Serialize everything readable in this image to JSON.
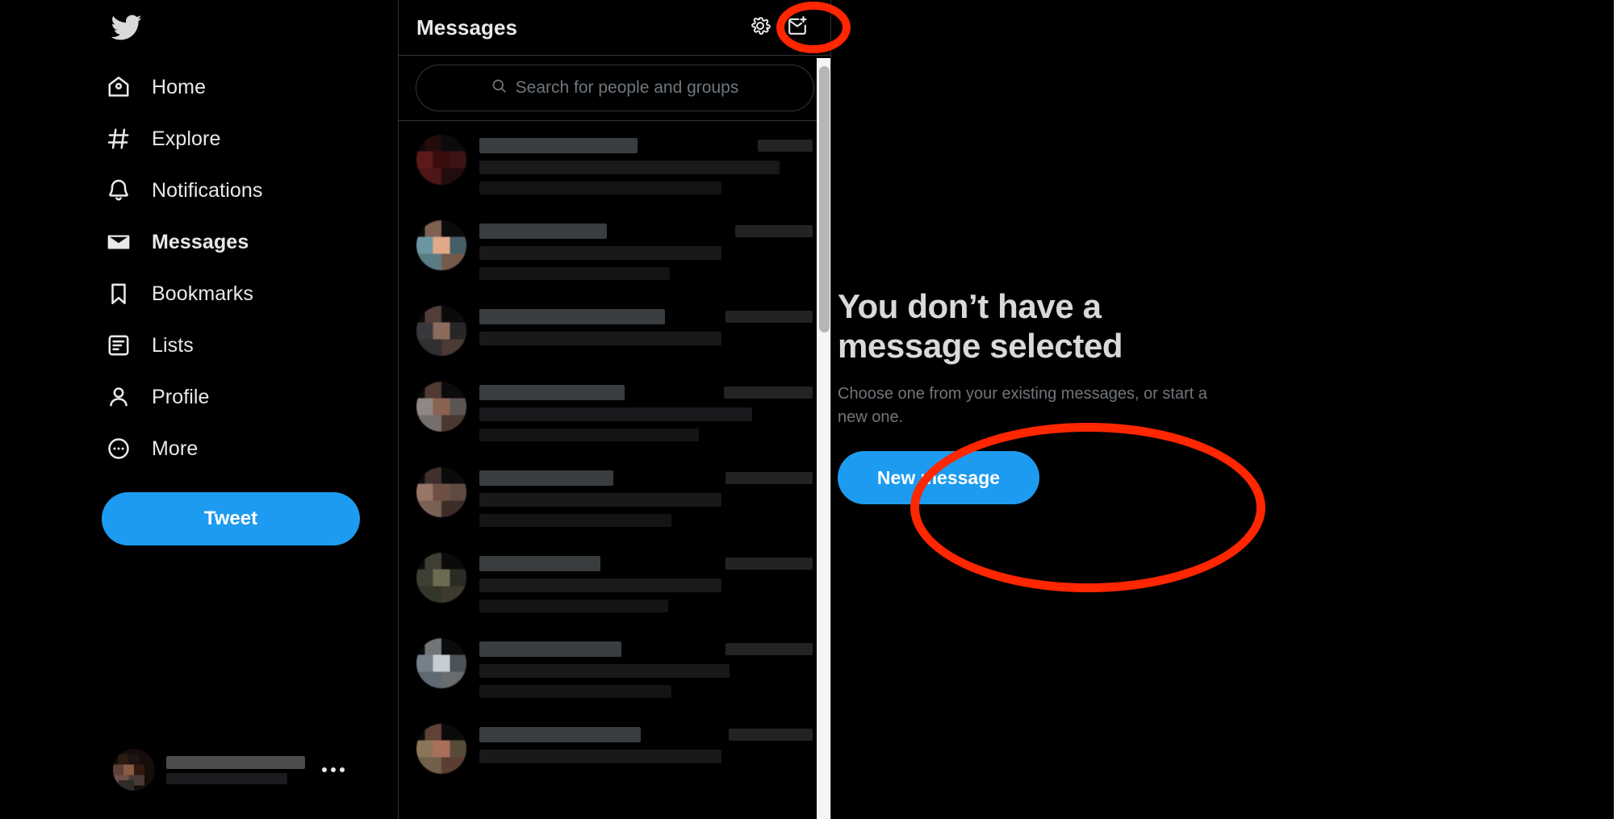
{
  "app": {
    "logo": "twitter-bird-logo",
    "accent_blue": "#1d9bf0",
    "annotation_color": "#ff2600",
    "background": "#000000"
  },
  "sidebar": {
    "items": [
      {
        "label": "Home",
        "icon": "home-icon",
        "active": false
      },
      {
        "label": "Explore",
        "icon": "hash-icon",
        "active": false
      },
      {
        "label": "Notifications",
        "icon": "bell-icon",
        "active": false
      },
      {
        "label": "Messages",
        "icon": "envelope-icon",
        "active": true
      },
      {
        "label": "Bookmarks",
        "icon": "bookmark-icon",
        "active": false
      },
      {
        "label": "Lists",
        "icon": "list-icon",
        "active": false
      },
      {
        "label": "Profile",
        "icon": "person-icon",
        "active": false
      },
      {
        "label": "More",
        "icon": "more-circle-icon",
        "active": false
      }
    ],
    "tweet_button_label": "Tweet",
    "account": {
      "name_redacted": true,
      "handle_redacted": true,
      "more_icon": "more-dots-icon"
    }
  },
  "messages_panel": {
    "title": "Messages",
    "settings_icon": "gear-icon",
    "new_message_icon": "new-message-envelope-icon",
    "search": {
      "placeholder": "Search for people and groups",
      "value": "",
      "icon": "search-icon"
    },
    "conversations": [
      {
        "avatar_color": "#7a1f1f",
        "avatar_color2": "#3a0d0d",
        "name_w": 196,
        "time_w": 68,
        "line_w": 372,
        "line2_w": 300,
        "redacted": true
      },
      {
        "avatar_color": "#8ec6d4",
        "avatar_color2": "#e0a98a",
        "name_w": 158,
        "time_w": 96,
        "line_w": 300,
        "line2_w": 236,
        "redacted": true
      },
      {
        "avatar_color": "#4a4a4c",
        "avatar_color2": "#8a6b5c",
        "name_w": 230,
        "time_w": 108,
        "line_w": 300,
        "line2_w": 0,
        "redacted": true
      },
      {
        "avatar_color": "#bdb2ad",
        "avatar_color2": "#8a6352",
        "name_w": 180,
        "time_w": 110,
        "line_w": 338,
        "line2_w": 272,
        "redacted": true
      },
      {
        "avatar_color": "#c79a86",
        "avatar_color2": "#6e4f44",
        "name_w": 166,
        "time_w": 108,
        "line_w": 300,
        "line2_w": 238,
        "redacted": true
      },
      {
        "avatar_color": "#4f5440",
        "avatar_color2": "#6d6a52",
        "name_w": 150,
        "time_w": 108,
        "line_w": 300,
        "line2_w": 234,
        "redacted": true
      },
      {
        "avatar_color": "#9aa8b5",
        "avatar_color2": "#c8cdd2",
        "name_w": 176,
        "time_w": 108,
        "line_w": 310,
        "line2_w": 238,
        "redacted": true
      },
      {
        "avatar_color": "#b79a74",
        "avatar_color2": "#a9705a",
        "name_w": 200,
        "time_w": 104,
        "line_w": 300,
        "line2_w": 0,
        "redacted": true
      }
    ],
    "scrollbar": {
      "visible": true,
      "thumb_position": "top"
    }
  },
  "main_pane": {
    "empty_state": {
      "title": "You don’t have a message selected",
      "subtitle": "Choose one from your existing messages, or start a new one.",
      "button_label": "New message"
    }
  },
  "annotations": [
    {
      "name": "new-message-icon-highlight",
      "shape": "ellipse",
      "color": "#ff2600"
    },
    {
      "name": "new-message-button-highlight",
      "shape": "ellipse",
      "color": "#ff2600"
    }
  ]
}
